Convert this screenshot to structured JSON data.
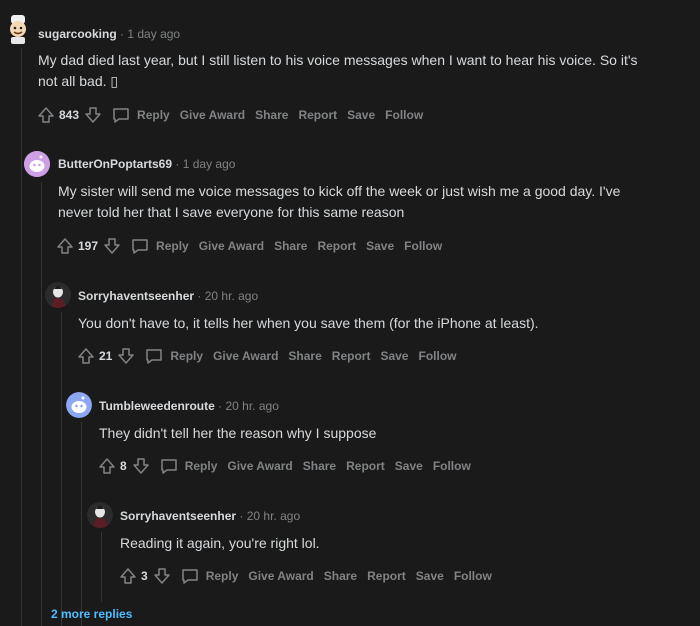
{
  "comments": [
    {
      "author": "sugarcooking",
      "time": "1 day ago",
      "body_lines": [
        "My dad died last year, but I still listen to his voice messages when I want to hear his voice. So it's",
        "not all bad. ▯"
      ],
      "score": "843",
      "avatar": "snoo-chef-icon"
    },
    {
      "author": "ButterOnPoptarts69",
      "time": "1 day ago",
      "body_lines": [
        "My sister will send me voice messages to kick off the week or just wish me a good day. I've",
        "never told her that I save everyone for this same reason"
      ],
      "score": "197",
      "avatar": "snoo-purple-icon"
    },
    {
      "author": "Sorryhaventseenher",
      "time": "20 hr. ago",
      "body_lines": [
        "You don't have to, it tells her when you save them (for the iPhone at least)."
      ],
      "score": "21",
      "avatar": "custom-avatar-icon"
    },
    {
      "author": "Tumbleweedenroute",
      "time": "20 hr. ago",
      "body_lines": [
        "They didn't tell her the reason why I suppose"
      ],
      "score": "8",
      "avatar": "snoo-blue-icon"
    },
    {
      "author": "Sorryhaventseenher",
      "time": "20 hr. ago",
      "body_lines": [
        "Reading it again, you're right lol."
      ],
      "score": "3",
      "avatar": "custom-avatar-icon"
    }
  ],
  "actions": {
    "reply": "Reply",
    "give_award": "Give Award",
    "share": "Share",
    "report": "Report",
    "save": "Save",
    "follow": "Follow"
  },
  "separator": "·",
  "more_replies": "2 more replies",
  "colors": {
    "background": "#1a1a1b",
    "text": "#d7dadc",
    "muted": "#818384",
    "link": "#4fbcff",
    "thread_line": "#343536"
  }
}
